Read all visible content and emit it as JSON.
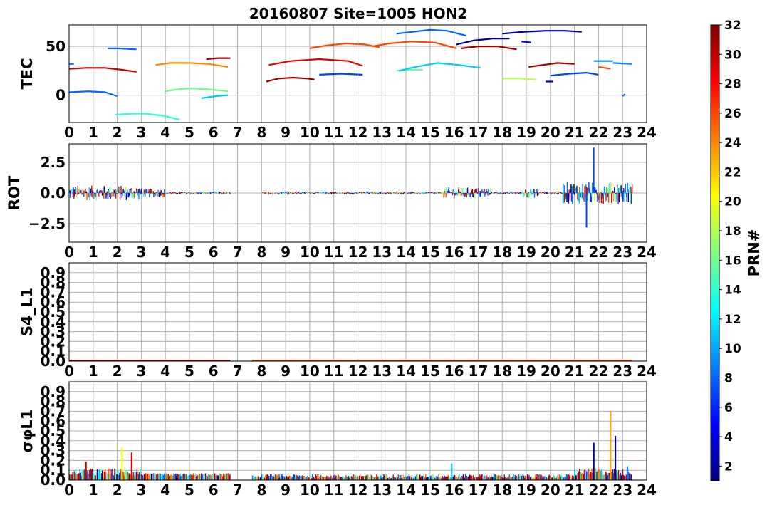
{
  "figure_title": "20160807 Site=1005 HON2",
  "x_ticks": [
    "0",
    "1",
    "2",
    "3",
    "4",
    "5",
    "6",
    "7",
    "8",
    "9",
    "10",
    "11",
    "12",
    "13",
    "14",
    "15",
    "16",
    "17",
    "18",
    "19",
    "20",
    "21",
    "22",
    "23",
    "24"
  ],
  "colorbar": {
    "label": "PRN#",
    "range": [
      1,
      32
    ],
    "ticks": [
      "2",
      "4",
      "6",
      "8",
      "10",
      "12",
      "14",
      "16",
      "18",
      "20",
      "22",
      "24",
      "26",
      "28",
      "30",
      "32"
    ],
    "colormap": "jet"
  },
  "chart_data": [
    {
      "type": "line",
      "panel": "TEC",
      "ylabel": "TEC",
      "xlim": [
        0,
        24
      ],
      "ylim": [
        -28,
        72
      ],
      "yticks": [
        "0",
        "50"
      ],
      "grid": true,
      "series": [
        {
          "prn": 9,
          "x": [
            0.0,
            0.2
          ],
          "y": [
            32,
            32
          ]
        },
        {
          "prn": 30,
          "x": [
            0.0,
            0.7,
            1.5,
            2.2,
            2.8
          ],
          "y": [
            27,
            28,
            28,
            26,
            24
          ]
        },
        {
          "prn": 8,
          "x": [
            0.0,
            0.8,
            1.5,
            2.0
          ],
          "y": [
            3,
            4,
            3,
            -1
          ]
        },
        {
          "prn": 14,
          "x": [
            1.9,
            2.6,
            3.2,
            3.9,
            4.6
          ],
          "y": [
            -20,
            -19,
            -19,
            -21,
            -25
          ]
        },
        {
          "prn": 8,
          "x": [
            1.6,
            2.0,
            2.8
          ],
          "y": [
            48,
            48,
            47
          ]
        },
        {
          "prn": 24,
          "x": [
            3.6,
            4.2,
            5.0,
            5.8,
            6.6
          ],
          "y": [
            31,
            33,
            33,
            32,
            29
          ]
        },
        {
          "prn": 16,
          "x": [
            4.0,
            4.5,
            5.0,
            5.8,
            6.6
          ],
          "y": [
            4,
            6,
            7,
            6,
            4
          ]
        },
        {
          "prn": 11,
          "x": [
            5.5,
            6.1,
            6.6
          ],
          "y": [
            -3,
            -1,
            0
          ]
        },
        {
          "prn": 31,
          "x": [
            5.7,
            6.2,
            6.7
          ],
          "y": [
            37,
            38,
            38
          ]
        },
        {
          "prn": 31,
          "x": [
            8.2,
            8.7,
            9.3,
            9.9,
            10.2
          ],
          "y": [
            14,
            17,
            18,
            17,
            16
          ]
        },
        {
          "prn": 29,
          "x": [
            8.3,
            9.2,
            10.4,
            11.6,
            12.2
          ],
          "y": [
            31,
            35,
            37,
            35,
            30
          ]
        },
        {
          "prn": 7,
          "x": [
            10.4,
            11.3,
            12.2
          ],
          "y": [
            21,
            22,
            21
          ]
        },
        {
          "prn": 26,
          "x": [
            10.0,
            10.7,
            11.5,
            12.3,
            12.9
          ],
          "y": [
            48,
            51,
            53,
            52,
            49
          ]
        },
        {
          "prn": 26,
          "x": [
            12.6,
            13.3,
            14.2,
            15.2,
            16.1
          ],
          "y": [
            50,
            53,
            55,
            54,
            48
          ]
        },
        {
          "prn": 16,
          "x": [
            13.6,
            14.2,
            14.7
          ],
          "y": [
            25,
            26,
            26
          ]
        },
        {
          "prn": 11,
          "x": [
            13.7,
            14.4,
            15.3,
            16.2,
            17.1
          ],
          "y": [
            25,
            29,
            33,
            31,
            28
          ]
        },
        {
          "prn": 8,
          "x": [
            13.6,
            14.3,
            15.0,
            15.7,
            16.5
          ],
          "y": [
            63,
            65,
            67,
            66,
            61
          ]
        },
        {
          "prn": 2,
          "x": [
            16.1,
            16.8,
            17.6,
            18.3
          ],
          "y": [
            52,
            56,
            58,
            58
          ]
        },
        {
          "prn": 31,
          "x": [
            16.3,
            17.0,
            17.8,
            18.6
          ],
          "y": [
            48,
            50,
            50,
            47
          ]
        },
        {
          "prn": 2,
          "x": [
            18.0,
            18.9,
            19.8,
            20.6,
            21.3
          ],
          "y": [
            63,
            65,
            66,
            66,
            65
          ]
        },
        {
          "prn": 4,
          "x": [
            18.8,
            19.2
          ],
          "y": [
            55,
            54
          ]
        },
        {
          "prn": 18,
          "x": [
            18.0,
            18.7,
            19.4
          ],
          "y": [
            17,
            17,
            16
          ]
        },
        {
          "prn": 31,
          "x": [
            19.1,
            19.7,
            20.3,
            21.0
          ],
          "y": [
            29,
            31,
            33,
            32
          ]
        },
        {
          "prn": 7,
          "x": [
            20.0,
            20.8,
            21.5,
            22.0
          ],
          "y": [
            20,
            22,
            23,
            21
          ]
        },
        {
          "prn": 4,
          "x": [
            19.8,
            20.1
          ],
          "y": [
            14,
            14
          ]
        },
        {
          "prn": 26,
          "x": [
            22.0,
            22.5
          ],
          "y": [
            29,
            27
          ]
        },
        {
          "prn": 9,
          "x": [
            21.8,
            22.6
          ],
          "y": [
            35,
            35
          ]
        },
        {
          "prn": 9,
          "x": [
            22.6,
            23.4
          ],
          "y": [
            33,
            32
          ]
        },
        {
          "prn": 8,
          "x": [
            23.0,
            23.1
          ],
          "y": [
            -1,
            1
          ]
        }
      ]
    },
    {
      "type": "line",
      "panel": "ROT",
      "ylabel": "ROT",
      "xlim": [
        0,
        24
      ],
      "ylim": [
        -4,
        4
      ],
      "yticks": [
        "−2.5",
        "0.0",
        "2.5"
      ],
      "grid": true,
      "data_gaps": [
        [
          6.7,
          8.0
        ]
      ],
      "notable_values": {
        "max": {
          "x": 21.8,
          "y": 3.7
        },
        "min": {
          "x": 21.5,
          "y": -2.8
        }
      },
      "series_prns": [
        30,
        8,
        14,
        24,
        16,
        31,
        29,
        26,
        11,
        2,
        18,
        7,
        4,
        9
      ]
    },
    {
      "type": "line",
      "panel": "S4_L1",
      "ylabel": "S4_L1",
      "xlim": [
        0,
        24
      ],
      "ylim": [
        0,
        1
      ],
      "yticks": [
        "0.0",
        "0.1",
        "0.2",
        "0.3",
        "0.4",
        "0.5",
        "0.6",
        "0.7",
        "0.8",
        "0.9"
      ],
      "grid": true,
      "baseline_value": 0.0,
      "data_gaps": [
        [
          6.7,
          7.6
        ]
      ]
    },
    {
      "type": "line",
      "panel": "sigma_phi_L1",
      "ylabel": "σφL1",
      "xlim": [
        0,
        24
      ],
      "ylim": [
        0,
        1
      ],
      "yticks": [
        "0.0",
        "0.1",
        "0.2",
        "0.3",
        "0.4",
        "0.5",
        "0.6",
        "0.7",
        "0.8",
        "0.9"
      ],
      "grid": true,
      "data_gaps": [
        [
          6.7,
          7.6
        ]
      ],
      "peaks": [
        {
          "x": 0.7,
          "y": 0.19,
          "prn": 30
        },
        {
          "x": 2.2,
          "y": 0.33,
          "prn": 20
        },
        {
          "x": 2.6,
          "y": 0.28,
          "prn": 29
        },
        {
          "x": 15.9,
          "y": 0.17,
          "prn": 11
        },
        {
          "x": 21.8,
          "y": 0.38,
          "prn": 2
        },
        {
          "x": 22.5,
          "y": 0.7,
          "prn": 23
        },
        {
          "x": 22.7,
          "y": 0.45,
          "prn": 2
        },
        {
          "x": 23.2,
          "y": 0.14,
          "prn": 9
        }
      ]
    }
  ]
}
